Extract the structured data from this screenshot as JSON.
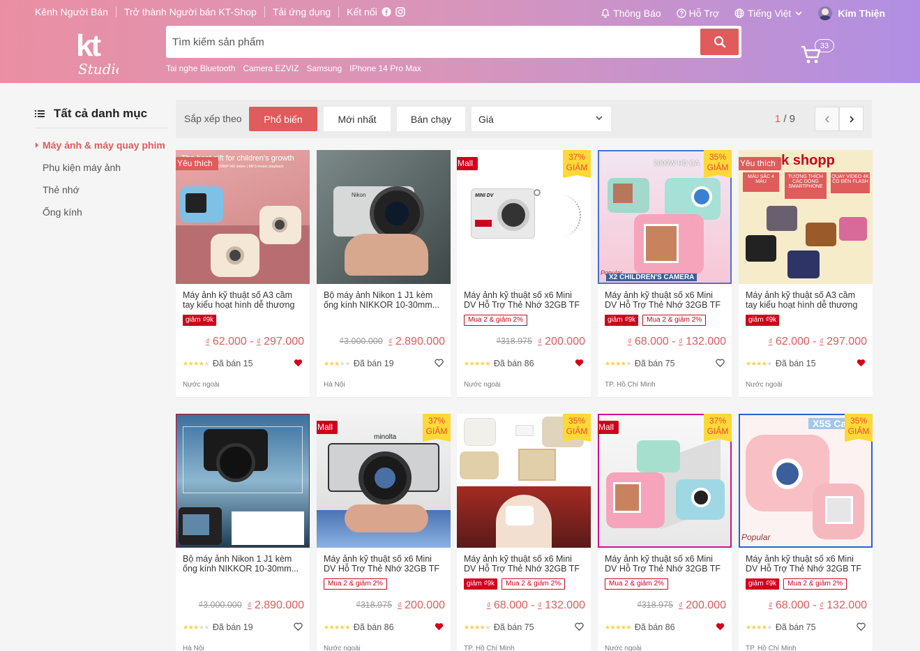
{
  "header": {
    "topnav_left": [
      "Kênh Người Bán",
      "Trở thành Người bán KT-Shop",
      "Tải ứng dụng",
      "Kết nối"
    ],
    "notifications": "Thông Báo",
    "support": "Hỗ Trợ",
    "language": "Tiếng Việt",
    "user": "Kim Thiện",
    "search_placeholder": "Tìm kiếm sản phẩm",
    "suggestions": [
      "Tai nghe Bluetooth",
      "Camera EZVIZ",
      "Samsung",
      "IPhone 14 Pro Max"
    ],
    "cart_count": "33"
  },
  "sidebar": {
    "title": "Tất cả danh mục",
    "items": [
      "Máy ảnh & máy quay phim",
      "Phụ kiện máy ảnh",
      "Thẻ nhớ",
      "Ống kính"
    ]
  },
  "sort": {
    "label": "Sắp xếp theo",
    "buttons": [
      "Phổ biến",
      "Mới nhất",
      "Bán chạy"
    ],
    "select": "Giá",
    "page_current": "1",
    "page_total": "/ 9"
  },
  "colors": {
    "accent": "#e05b5b",
    "mall": "#d0011b",
    "discount_bg": "#ffd839"
  },
  "products": [
    {
      "tag": "Yêu thích",
      "discount": "",
      "name": "Máy ảnh kỹ thuật số A3 cầm tay kiểu hoạt hình dễ thương",
      "badges": [
        "giảm ₫9k"
      ],
      "old": "",
      "price": "62.000 - ",
      "price2": "297.000",
      "stars": 4,
      "sold": "Đã bán 15",
      "liked": true,
      "loc": "Nước ngoài",
      "img": "kidcam"
    },
    {
      "tag": "",
      "discount": "",
      "name": "Bộ máy ảnh Nikon 1 J1 kèm ống kính NIKKOR 10-30mm...",
      "badges": [],
      "old": "₫3.000.000",
      "price": "2.890.000",
      "price2": "",
      "stars": 3,
      "sold": "Đã bán 19",
      "liked": false,
      "loc": "Hà Nội",
      "img": "nikonhand"
    },
    {
      "tag": "Mall",
      "discount": "37%",
      "name": "Máy ảnh kỹ thuật số x6 Mini DV Hỗ Trợ Thẻ Nhớ 32GB TF",
      "badges": [
        "Mua 2 & giảm 2%"
      ],
      "old": "₫318.975",
      "price": "200.000",
      "price2": "",
      "stars": 5,
      "sold": "Đã bán 86",
      "liked": true,
      "loc": "Nước ngoài",
      "img": "minidv"
    },
    {
      "tag": "",
      "discount": "35%",
      "name": "Máy ảnh kỹ thuật số x6 Mini DV Hỗ Trợ Thẻ Nhớ 32GB TF",
      "badges": [
        "giảm ₫9k",
        "Mua 2 & giảm 2%"
      ],
      "old": "",
      "price": "68.000 - ",
      "price2": "132.000",
      "stars": 4,
      "sold": "Đã bán 75",
      "liked": false,
      "loc": "TP. Hồ Chí Minh",
      "img": "x2kids"
    },
    {
      "tag": "Yêu thích",
      "discount": "",
      "name": "Máy ảnh kỹ thuật số A3 cầm tay kiểu hoạt hình dễ thương",
      "badges": [
        "giảm ₫9k"
      ],
      "old": "",
      "price": "62.000 - ",
      "price2": "297.000",
      "stars": 4,
      "sold": "Đã bán 15",
      "liked": true,
      "loc": "Nước ngoài",
      "img": "shopp"
    },
    {
      "tag": "",
      "discount": "",
      "name": "Bộ máy ảnh Nikon 1 J1 kèm ống kính NIKKOR 10-30mm...",
      "badges": [],
      "old": "₫3.000.000",
      "price": "2.890.000",
      "price2": "",
      "stars": 3,
      "sold": "Đã bán 19",
      "liked": false,
      "loc": "Hà Nội",
      "img": "dslr"
    },
    {
      "tag": "Mall",
      "discount": "37%",
      "name": "Máy ảnh kỹ thuật số x6 Mini DV Hỗ Trợ Thẻ Nhớ 32GB TF",
      "badges": [
        "Mua 2 & giảm 2%"
      ],
      "old": "₫318.975",
      "price": "200.000",
      "price2": "",
      "stars": 5,
      "sold": "Đã bán 86",
      "liked": true,
      "loc": "Nước ngoài",
      "img": "minolta"
    },
    {
      "tag": "",
      "discount": "35%",
      "name": "Máy ảnh kỹ thuật số x6 Mini DV Hỗ Trợ Thẻ Nhớ 32GB TF",
      "badges": [
        "giảm ₫9k",
        "Mua 2 & giảm 2%"
      ],
      "old": "",
      "price": "68.000 - ",
      "price2": "132.000",
      "stars": 4,
      "sold": "Đã bán 75",
      "liked": false,
      "loc": "TP. Hồ Chí Minh",
      "img": "kidphoto"
    },
    {
      "tag": "Mall",
      "discount": "37%",
      "name": "Máy ảnh kỹ thuật số x6 Mini DV Hỗ Trợ Thẻ Nhớ 32GB TF",
      "badges": [
        "Mua 2 & giảm 2%"
      ],
      "old": "₫318.975",
      "price": "200.000",
      "price2": "",
      "stars": 5,
      "sold": "Đã bán 86",
      "liked": true,
      "loc": "Nước ngoài",
      "img": "kidsbox"
    },
    {
      "tag": "",
      "discount": "35%",
      "name": "Máy ảnh kỹ thuật số x6 Mini DV Hỗ Trợ Thẻ Nhớ 32GB TF",
      "badges": [
        "giảm ₫9k",
        "Mua 2 & giảm 2%"
      ],
      "old": "",
      "price": "68.000 - ",
      "price2": "132.000",
      "stars": 4,
      "sold": "Đã bán 75",
      "liked": false,
      "loc": "TP. Hồ Chí Minh",
      "img": "x5s"
    }
  ],
  "image_text": {
    "kidcam": "Tha best gift for children's growth",
    "kidcam_sub": "1080P HD video | MP3 music playback",
    "minidv": "MINI DV",
    "x2kids_top": "2000W HD CA",
    "x2kids_bottom": "X2 CHILDREN'S CAMERA",
    "x2kids_pop": "Popular",
    "shopp_title": "ck shopp",
    "shopp_b1": "MÀU SẮC 4 MÀU",
    "shopp_b2": "TƯƠNG THÍCH CÁC DÒNG SMARTPHONE",
    "shopp_b3": "QUAY VIDEO 4K CÓ ĐÈN FLASH",
    "x5s_title": "X5S Ca",
    "x5s_pop": "Popular",
    "nikon": "Nikon",
    "minolta": "minolta"
  }
}
